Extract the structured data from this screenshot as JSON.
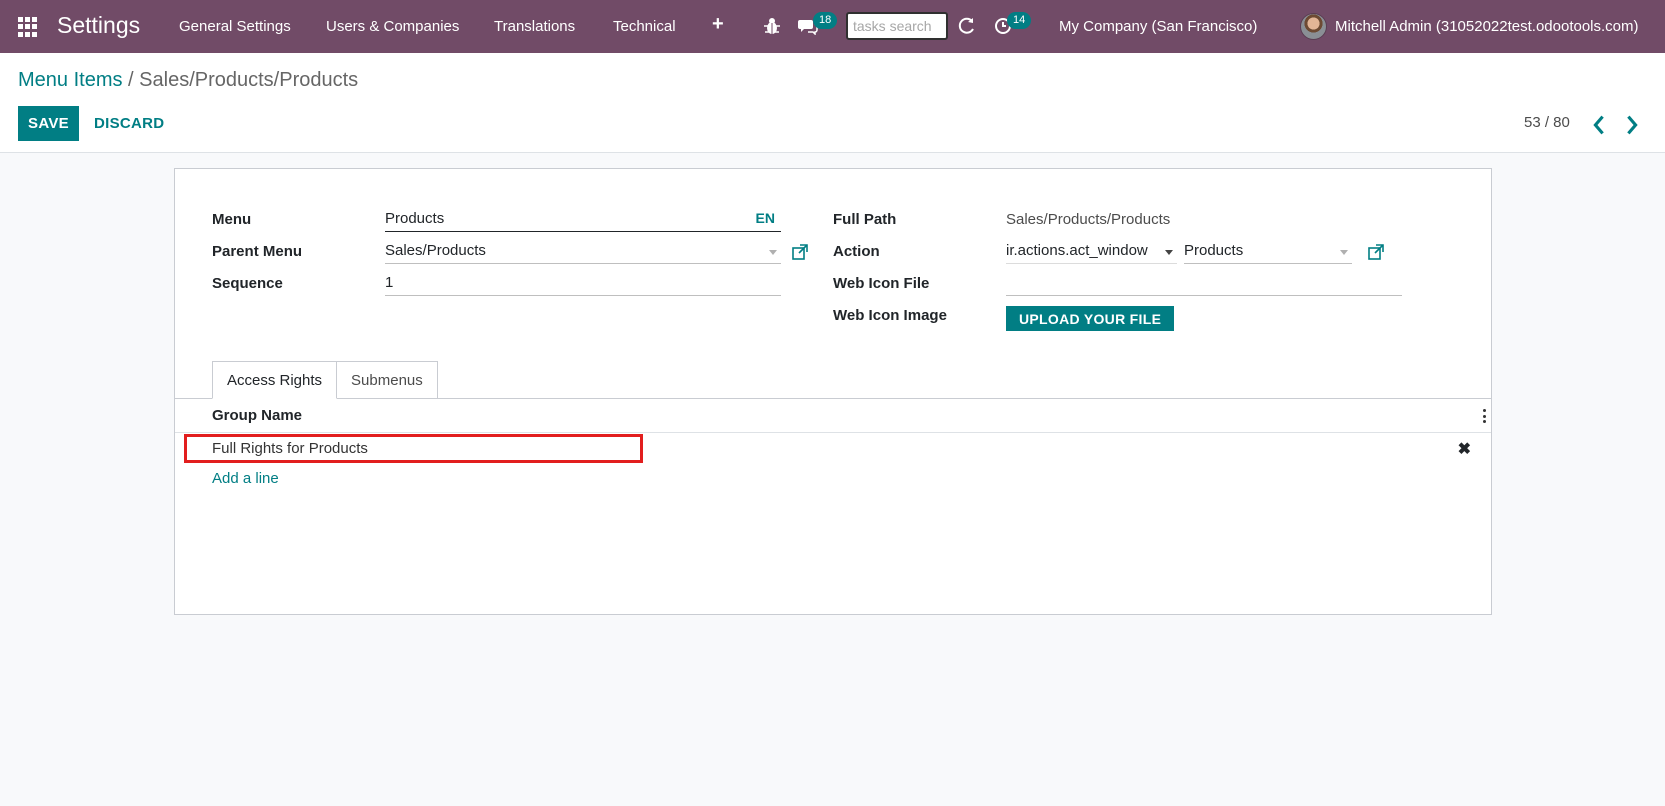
{
  "navbar": {
    "app_title": "Settings",
    "menu": [
      "General Settings",
      "Users & Companies",
      "Translations",
      "Technical"
    ],
    "chat_badge": "18",
    "search_placeholder": "tasks search",
    "activity_badge": "14",
    "company": "My Company (San Francisco)",
    "user": "Mitchell Admin (31052022test.odootools.com)"
  },
  "breadcrumb": {
    "parent": "Menu Items",
    "separator": "/",
    "current": "Sales/Products/Products"
  },
  "buttons": {
    "save": "SAVE",
    "discard": "DISCARD",
    "upload": "UPLOAD YOUR FILE"
  },
  "pager": {
    "value": "53 / 80"
  },
  "form": {
    "menu_label": "Menu",
    "menu_value": "Products",
    "menu_lang": "EN",
    "parent_label": "Parent Menu",
    "parent_value": "Sales/Products",
    "sequence_label": "Sequence",
    "sequence_value": "1",
    "full_path_label": "Full Path",
    "full_path_value": "Sales/Products/Products",
    "action_label": "Action",
    "action_type": "ir.actions.act_window",
    "action_value": "Products",
    "web_icon_file_label": "Web Icon File",
    "web_icon_file_value": "",
    "web_icon_image_label": "Web Icon Image"
  },
  "tabs": [
    "Access Rights",
    "Submenus"
  ],
  "list": {
    "header": "Group Name",
    "rows": [
      "Full Rights for Products"
    ],
    "add_line": "Add a line"
  },
  "colors": {
    "navbar": "#714b67",
    "primary": "#017e84",
    "highlight": "#e21e1e"
  }
}
